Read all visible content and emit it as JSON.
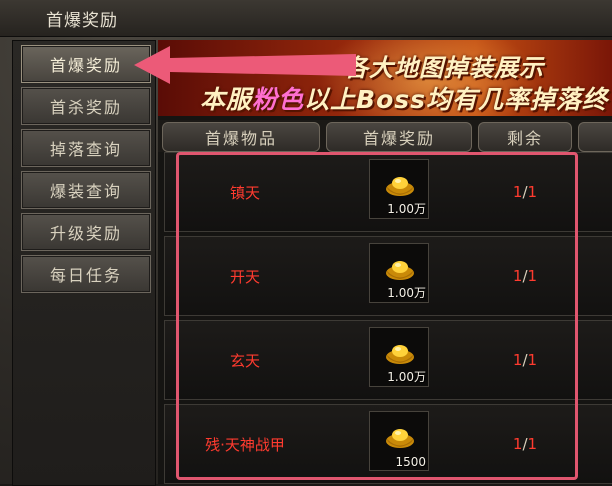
{
  "window": {
    "title": "首爆奖励"
  },
  "sidebar": {
    "items": [
      {
        "label": "首爆奖励",
        "active": true
      },
      {
        "label": "首杀奖励",
        "active": false
      },
      {
        "label": "掉落查询",
        "active": false
      },
      {
        "label": "爆装查询",
        "active": false
      },
      {
        "label": "升级奖励",
        "active": false
      },
      {
        "label": "每日任务",
        "active": false
      }
    ]
  },
  "banner": {
    "line1": "各大地图掉装展示",
    "line2_prefix": "本服",
    "line2_highlight": "粉色",
    "line2_suffix": "以上Boss均有几率掉落终"
  },
  "table": {
    "headers": [
      "首爆物品",
      "首爆奖励",
      "剩余",
      ""
    ],
    "rows": [
      {
        "item": "镇天",
        "reward_amount": "1.00万",
        "remaining": "1",
        "total": "1"
      },
      {
        "item": "开天",
        "reward_amount": "1.00万",
        "remaining": "1",
        "total": "1"
      },
      {
        "item": "玄天",
        "reward_amount": "1.00万",
        "remaining": "1",
        "total": "1"
      },
      {
        "item": "残·天神战甲",
        "reward_amount": "1500",
        "remaining": "1",
        "total": "1"
      }
    ]
  },
  "icons": {
    "reward": "gold-ingot-icon"
  },
  "colors": {
    "item_name": "#ff3b2f",
    "highlight_box": "#e0566f",
    "banner_pink": "#ff6fd0"
  }
}
